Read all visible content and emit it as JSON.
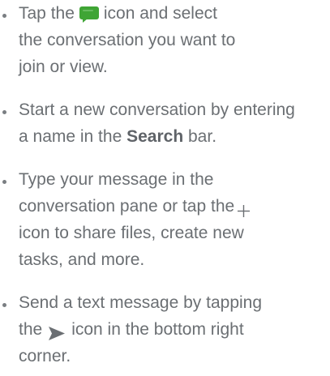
{
  "instructions": {
    "item1": {
      "line1_before": "Tap the",
      "line1_after": "icon and select",
      "line2": "the conversation you want to",
      "line3": "join or view."
    },
    "item2": {
      "line1": "Start a new conversation by entering",
      "line2_before": "a name in the",
      "line2_bold": "Search",
      "line2_after": "bar."
    },
    "item3": {
      "line1": "Type your message in the",
      "line2_before": "conversation pane or tap the",
      "line3": "icon to share files, create new",
      "line4": "tasks, and more."
    },
    "item4": {
      "line1": "Send a text message by tapping",
      "line2_before": "the",
      "line2_after": "icon in the bottom right",
      "line3": "corner."
    }
  },
  "icons": {
    "chat": "chat-icon",
    "plus": "plus-icon",
    "send": "send-icon"
  },
  "colors": {
    "text": "#6b6f73",
    "chat_icon": "#3fa535"
  }
}
